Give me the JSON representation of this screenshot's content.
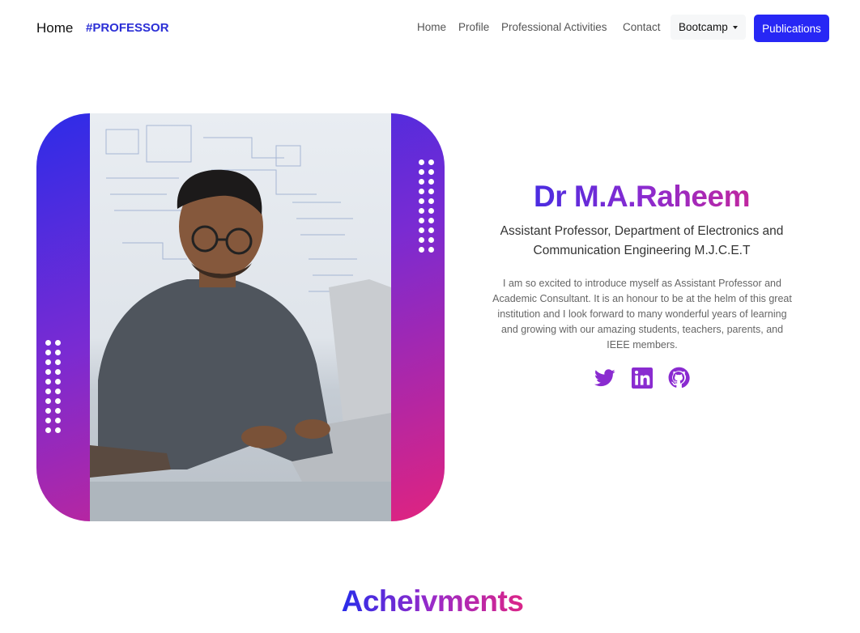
{
  "navbar": {
    "brand_home": "Home",
    "brand_tag": "#PROFESSOR",
    "links": [
      "Home",
      "Profile",
      "Professional Activities",
      "Contact"
    ],
    "dropdown_label": "Bootcamp",
    "publications_label": "Publications"
  },
  "hero": {
    "photo_icon": "portrait-photo"
  },
  "profile": {
    "name": "Dr M.A.Raheem",
    "title": "Assistant Professor, Department of Electronics and Communication Engineering M.J.C.E.T",
    "bio": "I am so excited to introduce myself as Assistant Professor and Academic Consultant. It is an honour to be at the helm of this great institution and I look forward to many wonderful years of learning and growing with our amazing students, teachers, parents, and IEEE members."
  },
  "socials": {
    "icons": [
      "twitter-icon",
      "linkedin-icon",
      "github-icon"
    ],
    "color": "#8a2bd0"
  },
  "achievements": {
    "heading": "Acheivments"
  }
}
